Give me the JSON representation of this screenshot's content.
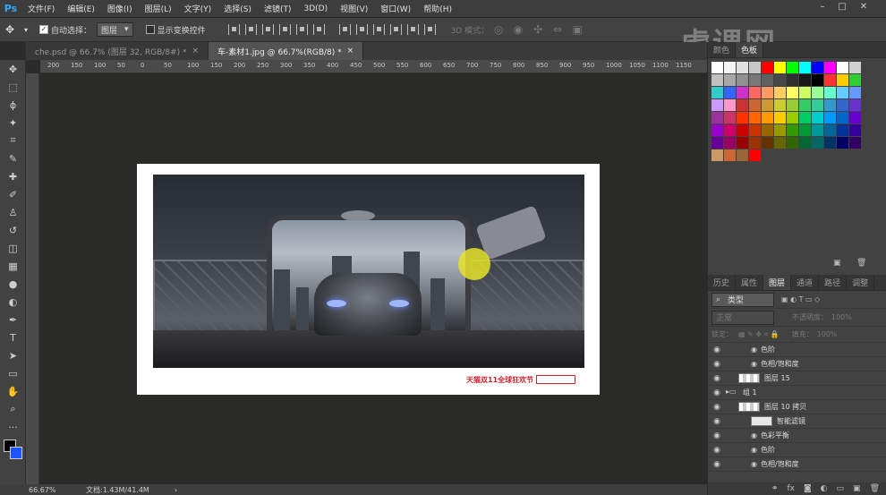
{
  "app": {
    "logo": "Ps"
  },
  "menu": [
    "文件(F)",
    "编辑(E)",
    "图像(I)",
    "图层(L)",
    "文字(Y)",
    "选择(S)",
    "滤镜(T)",
    "3D(D)",
    "视图(V)",
    "窗口(W)",
    "帮助(H)"
  ],
  "options": {
    "auto_select_label": "自动选择：",
    "auto_select_value": "图层",
    "show_transform_label": "显示变换控件",
    "mode_3d_label": "3D 模式："
  },
  "watermark": "虎课网",
  "tabs": [
    {
      "label": "che.psd @ 66.7% (图层 32, RGB/8#) *",
      "close": "×"
    },
    {
      "label": "车-素材1.jpg @ 66.7%(RGB/8) *",
      "close": "×"
    }
  ],
  "ruler_ticks": [
    "200",
    "150",
    "100",
    "50",
    "0",
    "50",
    "100",
    "150",
    "200",
    "250",
    "300",
    "350",
    "400",
    "450",
    "500",
    "550",
    "600",
    "650",
    "700",
    "750",
    "800",
    "850",
    "900",
    "950",
    "1000",
    "1050",
    "1100",
    "1150"
  ],
  "canvas": {
    "logo_text": "天猫双11全球狂欢节"
  },
  "status": {
    "zoom": "66.67%",
    "doc_info": "文档:1.43M/41.4M"
  },
  "right_panel": {
    "top_tabs": [
      "颜色",
      "色板"
    ],
    "layer_tabs": [
      "历史",
      "属性",
      "图层",
      "通道",
      "路径",
      "调整"
    ],
    "filter_label": "类型",
    "blend_mode": "正常",
    "opacity_label": "不透明度：",
    "opacity_value": "100%",
    "lock_label": "锁定：",
    "fill_label": "填充：",
    "fill_value": "100%"
  },
  "layers": [
    {
      "name": "色阶",
      "indent": 2,
      "thumb": "none"
    },
    {
      "name": "色相/饱和度",
      "indent": 2,
      "thumb": "none"
    },
    {
      "name": "图层 15",
      "indent": 1,
      "thumb": "checker"
    },
    {
      "name": "组 1",
      "indent": 0,
      "thumb": "folder"
    },
    {
      "name": "图层 10 拷贝",
      "indent": 1,
      "thumb": "checker"
    },
    {
      "name": "智能滤镜",
      "indent": 2,
      "thumb": "white"
    },
    {
      "name": "色彩平衡",
      "indent": 2,
      "thumb": "none"
    },
    {
      "name": "色阶",
      "indent": 2,
      "thumb": "none"
    },
    {
      "name": "色相/饱和度",
      "indent": 2,
      "thumb": "none"
    }
  ],
  "swatch_colors": [
    "#ffffff",
    "#f5f5f5",
    "#e0e0e0",
    "#c8c8c8",
    "#ff0000",
    "#ffff00",
    "#00ff00",
    "#00ffff",
    "#0000ff",
    "#ff00ff",
    "#ffffff",
    "#d0d0d0",
    "#c0c0c0",
    "#a8a8a8",
    "#909090",
    "#787878",
    "#606060",
    "#484848",
    "#303030",
    "#181818",
    "#000000",
    "#ff3333",
    "#ffcc00",
    "#33cc33",
    "#33cccc",
    "#3366ff",
    "#cc33cc",
    "#ff6666",
    "#ff9966",
    "#ffcc66",
    "#ffff66",
    "#ccff66",
    "#99ff99",
    "#66ffcc",
    "#66ccff",
    "#6699ff",
    "#cc99ff",
    "#ff99cc",
    "#cc3333",
    "#cc6633",
    "#cc9933",
    "#cccc33",
    "#99cc33",
    "#33cc66",
    "#33cc99",
    "#3399cc",
    "#3366cc",
    "#6633cc",
    "#993399",
    "#cc3366",
    "#ff3300",
    "#ff6600",
    "#ff9900",
    "#ffcc00",
    "#99cc00",
    "#00cc66",
    "#00cccc",
    "#0099ff",
    "#0066cc",
    "#6600cc",
    "#9900cc",
    "#cc0066",
    "#cc0000",
    "#cc3300",
    "#996600",
    "#999900",
    "#339900",
    "#009933",
    "#009999",
    "#006699",
    "#003399",
    "#330099",
    "#660099",
    "#990066",
    "#990000",
    "#993300",
    "#663300",
    "#666600",
    "#336600",
    "#006633",
    "#006666",
    "#003366",
    "#000066",
    "#330066",
    "#cc9966",
    "#cc6633",
    "#996633",
    "#ff0000"
  ],
  "icons": {
    "move": "✥",
    "marquee": "⬚",
    "lasso": "ϕ",
    "magic": "✦",
    "crop": "⌗",
    "eyedropper": "✎",
    "heal": "✚",
    "brush": "✐",
    "stamp": "♙",
    "history": "↺",
    "eraser": "◫",
    "gradient": "▦",
    "blur": "💧",
    "dodge": "◐",
    "pen": "✒",
    "type": "T",
    "path": "➤",
    "shape": "▭",
    "hand": "✋",
    "zoom": "🔍"
  }
}
